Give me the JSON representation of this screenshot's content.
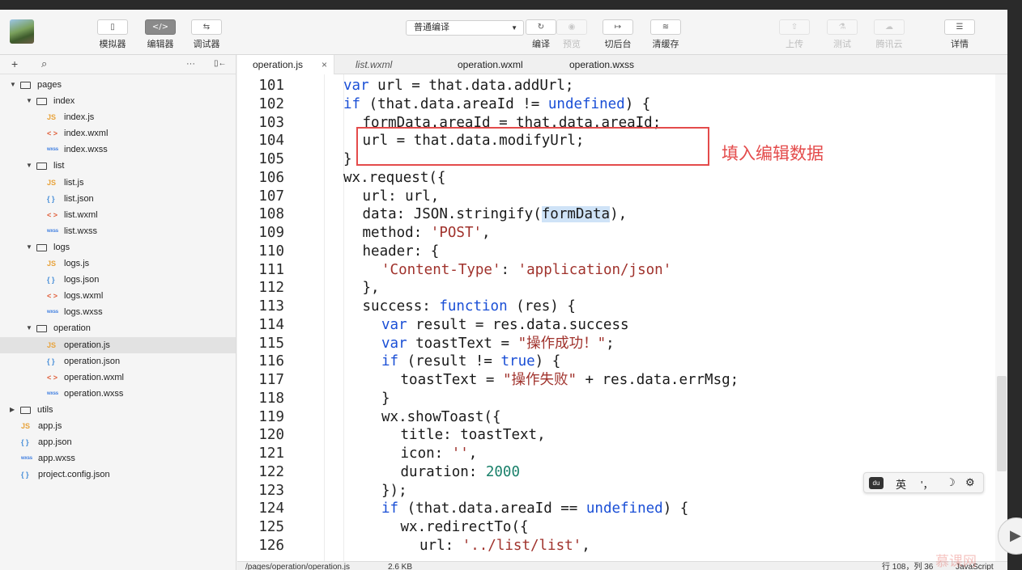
{
  "toolbar": {
    "left_buttons": [
      {
        "label": "模拟器",
        "icon": "phone-icon",
        "glyph": "▯",
        "active": false
      },
      {
        "label": "编辑器",
        "icon": "code-icon",
        "glyph": "</>",
        "active": true
      },
      {
        "label": "调试器",
        "icon": "debug-icon",
        "glyph": "⇆",
        "active": false
      }
    ],
    "compile_mode": "普通编译",
    "middle_buttons": [
      {
        "label": "编译",
        "icon": "refresh-icon",
        "glyph": "↻",
        "dim": false
      },
      {
        "label": "预览",
        "icon": "eye-icon",
        "glyph": "◉",
        "dim": true
      },
      {
        "label": "切后台",
        "icon": "switch-background-icon",
        "glyph": "↦",
        "dim": false
      },
      {
        "label": "清缓存",
        "icon": "layers-icon",
        "glyph": "≋",
        "dim": false
      }
    ],
    "right_buttons": [
      {
        "label": "上传",
        "icon": "upload-icon",
        "glyph": "⇧",
        "dim": true
      },
      {
        "label": "测试",
        "icon": "flask-icon",
        "glyph": "⚗",
        "dim": true
      },
      {
        "label": "腾讯云",
        "icon": "cloud-icon",
        "glyph": "☁",
        "dim": true
      },
      {
        "label": "详情",
        "icon": "menu-icon",
        "glyph": "☰",
        "dim": false
      }
    ]
  },
  "sidebar": {
    "tools": {
      "add": "+",
      "search": "⌕",
      "more": "···",
      "collapse": "▯←"
    },
    "tree": [
      {
        "name": "pages",
        "type": "folder",
        "depth": 0,
        "open": true
      },
      {
        "name": "index",
        "type": "folder",
        "depth": 1,
        "open": true
      },
      {
        "name": "index.js",
        "type": "js",
        "depth": 2
      },
      {
        "name": "index.wxml",
        "type": "wxml",
        "depth": 2
      },
      {
        "name": "index.wxss",
        "type": "wxss",
        "depth": 2
      },
      {
        "name": "list",
        "type": "folder",
        "depth": 1,
        "open": true
      },
      {
        "name": "list.js",
        "type": "js",
        "depth": 2
      },
      {
        "name": "list.json",
        "type": "json",
        "depth": 2
      },
      {
        "name": "list.wxml",
        "type": "wxml",
        "depth": 2
      },
      {
        "name": "list.wxss",
        "type": "wxss",
        "depth": 2
      },
      {
        "name": "logs",
        "type": "folder",
        "depth": 1,
        "open": true
      },
      {
        "name": "logs.js",
        "type": "js",
        "depth": 2
      },
      {
        "name": "logs.json",
        "type": "json",
        "depth": 2
      },
      {
        "name": "logs.wxml",
        "type": "wxml",
        "depth": 2
      },
      {
        "name": "logs.wxss",
        "type": "wxss",
        "depth": 2
      },
      {
        "name": "operation",
        "type": "folder",
        "depth": 1,
        "open": true
      },
      {
        "name": "operation.js",
        "type": "js",
        "depth": 2,
        "selected": true
      },
      {
        "name": "operation.json",
        "type": "json",
        "depth": 2
      },
      {
        "name": "operation.wxml",
        "type": "wxml",
        "depth": 2
      },
      {
        "name": "operation.wxss",
        "type": "wxss",
        "depth": 2
      },
      {
        "name": "utils",
        "type": "folder",
        "depth": 0,
        "open": false
      },
      {
        "name": "app.js",
        "type": "js",
        "depth": 0
      },
      {
        "name": "app.json",
        "type": "json",
        "depth": 0
      },
      {
        "name": "app.wxss",
        "type": "wxss",
        "depth": 0
      },
      {
        "name": "project.config.json",
        "type": "json",
        "depth": 0
      }
    ],
    "file_badges": {
      "js": "JS",
      "json": "{ }",
      "wxml": "< >",
      "wxss": "wxss"
    }
  },
  "tabs": [
    {
      "label": "operation.js",
      "active": true,
      "italic": false,
      "close": "×"
    },
    {
      "label": "list.wxml",
      "active": false,
      "italic": true
    },
    {
      "label": "operation.wxml",
      "active": false,
      "italic": false
    },
    {
      "label": "operation.wxss",
      "active": false,
      "italic": false
    }
  ],
  "code": [
    {
      "n": "101",
      "indent": 0,
      "t": [
        [
          "kw",
          "var"
        ],
        [
          "p",
          " url = that.data.addUrl;"
        ]
      ]
    },
    {
      "n": "102",
      "indent": 0,
      "t": [
        [
          "kw",
          "if"
        ],
        [
          "p",
          " (that.data.areaId != "
        ],
        [
          "kw",
          "undefined"
        ],
        [
          "p",
          ") {"
        ]
      ]
    },
    {
      "n": "103",
      "indent": 1,
      "t": [
        [
          "p",
          "formData.areaId = that.data.areaId;"
        ]
      ]
    },
    {
      "n": "104",
      "indent": 1,
      "t": [
        [
          "p",
          "url = that.data.modifyUrl;"
        ]
      ]
    },
    {
      "n": "105",
      "indent": 0,
      "t": [
        [
          "p",
          "}"
        ]
      ]
    },
    {
      "n": "106",
      "indent": 0,
      "t": [
        [
          "p",
          "wx.request({"
        ]
      ]
    },
    {
      "n": "107",
      "indent": 1,
      "t": [
        [
          "p",
          "url: url,"
        ]
      ]
    },
    {
      "n": "108",
      "indent": 1,
      "t": [
        [
          "p",
          "data: JSON.stringify("
        ],
        [
          "hl",
          "formData"
        ],
        [
          "p",
          "),"
        ]
      ]
    },
    {
      "n": "109",
      "indent": 1,
      "t": [
        [
          "p",
          "method: "
        ],
        [
          "str",
          "'POST'"
        ],
        [
          "p",
          ","
        ]
      ]
    },
    {
      "n": "110",
      "indent": 1,
      "t": [
        [
          "p",
          "header: {"
        ]
      ]
    },
    {
      "n": "111",
      "indent": 2,
      "t": [
        [
          "str",
          "'Content-Type'"
        ],
        [
          "p",
          ": "
        ],
        [
          "str",
          "'application/json'"
        ]
      ]
    },
    {
      "n": "112",
      "indent": 1,
      "t": [
        [
          "p",
          "},"
        ]
      ]
    },
    {
      "n": "113",
      "indent": 1,
      "t": [
        [
          "p",
          "success: "
        ],
        [
          "kw",
          "function"
        ],
        [
          "p",
          " (res) {"
        ]
      ]
    },
    {
      "n": "114",
      "indent": 2,
      "t": [
        [
          "kw",
          "var"
        ],
        [
          "p",
          " result = res.data.success"
        ]
      ]
    },
    {
      "n": "115",
      "indent": 2,
      "t": [
        [
          "kw",
          "var"
        ],
        [
          "p",
          " toastText = "
        ],
        [
          "str",
          "\"操作成功！\""
        ],
        [
          "p",
          ";"
        ]
      ]
    },
    {
      "n": "116",
      "indent": 2,
      "t": [
        [
          "kw",
          "if"
        ],
        [
          "p",
          " (result != "
        ],
        [
          "kw",
          "true"
        ],
        [
          "p",
          ") {"
        ]
      ]
    },
    {
      "n": "117",
      "indent": 3,
      "t": [
        [
          "p",
          "toastText = "
        ],
        [
          "str",
          "\"操作失败\""
        ],
        [
          "p",
          " + res.data.errMsg;"
        ]
      ]
    },
    {
      "n": "118",
      "indent": 2,
      "t": [
        [
          "p",
          "}"
        ]
      ]
    },
    {
      "n": "119",
      "indent": 2,
      "t": [
        [
          "p",
          "wx.showToast({"
        ]
      ]
    },
    {
      "n": "120",
      "indent": 3,
      "t": [
        [
          "p",
          "title: toastText,"
        ]
      ]
    },
    {
      "n": "121",
      "indent": 3,
      "t": [
        [
          "p",
          "icon: "
        ],
        [
          "str",
          "''"
        ],
        [
          "p",
          ","
        ]
      ]
    },
    {
      "n": "122",
      "indent": 3,
      "t": [
        [
          "p",
          "duration: "
        ],
        [
          "num",
          "2000"
        ]
      ]
    },
    {
      "n": "123",
      "indent": 2,
      "t": [
        [
          "p",
          "});"
        ]
      ]
    },
    {
      "n": "124",
      "indent": 2,
      "t": [
        [
          "kw",
          "if"
        ],
        [
          "p",
          " (that.data.areaId == "
        ],
        [
          "kw",
          "undefined"
        ],
        [
          "p",
          ") {"
        ]
      ]
    },
    {
      "n": "125",
      "indent": 3,
      "t": [
        [
          "p",
          "wx.redirectTo({"
        ]
      ]
    },
    {
      "n": "126",
      "indent": 4,
      "t": [
        [
          "p",
          "url: "
        ],
        [
          "str",
          "'../list/list'"
        ],
        [
          "p",
          ","
        ]
      ]
    }
  ],
  "annotation": {
    "text": "填入编辑数据"
  },
  "ime": {
    "brand": "du",
    "lang": "英",
    "punct": "'，",
    "moon": "☽",
    "gear": "⚙"
  },
  "status": {
    "path": "/pages/operation/operation.js",
    "size": "2.6 KB",
    "cursor": "行 108，列 36",
    "language": "JavaScript"
  },
  "watermark": "慕课网",
  "colors": {
    "keyword": "#1a4fd6",
    "string": "#a0322c",
    "number": "#19806a",
    "annotation": "#e44b4b",
    "highlight": "#cfe3f7"
  }
}
